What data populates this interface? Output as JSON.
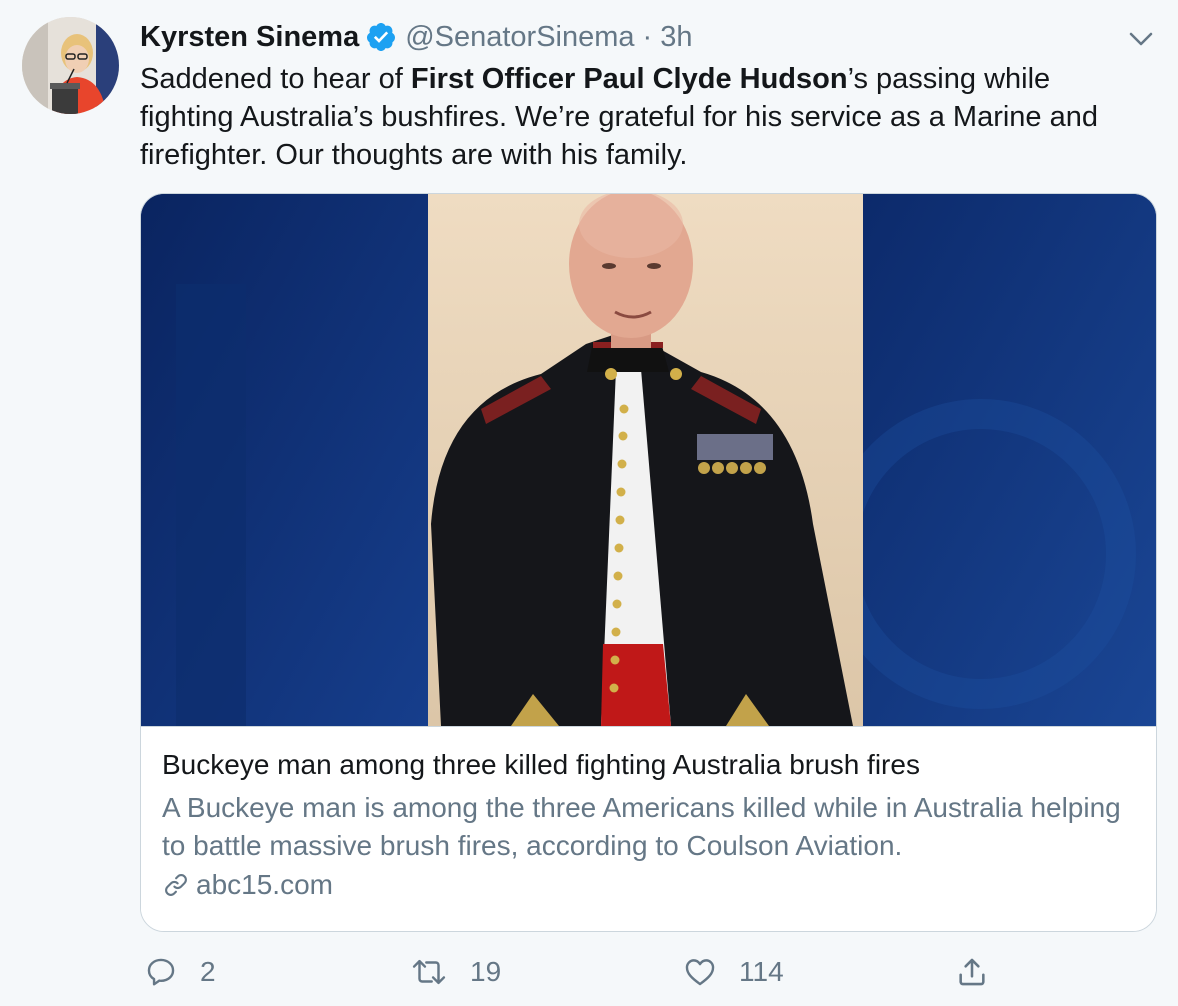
{
  "tweet": {
    "author_name": "Kyrsten Sinema",
    "handle": "@SenatorSinema",
    "separator": "·",
    "time": "3h",
    "text_part1": "Saddened to hear of ",
    "text_bold": "First Officer Paul Clyde Hudson",
    "text_part2": "’s passing while fighting Australia’s bushfires. We’re grateful for his service as a Marine and firefighter. Our thoughts are with his family."
  },
  "card": {
    "title": "Buckeye man among three killed fighting Australia brush fires",
    "description": "A Buckeye man is among the three Americans killed while in Australia helping to battle massive brush fires, according to Coulson Aviation.",
    "domain": "abc15.com"
  },
  "actions": {
    "replies": "2",
    "retweets": "19",
    "likes": "114"
  },
  "icons": {
    "verified": "verified-badge-icon",
    "caret": "chevron-down-icon",
    "reply": "reply-bubble-icon",
    "retweet": "retweet-arrows-icon",
    "like": "heart-icon",
    "share": "share-upload-icon",
    "link": "link-chain-icon"
  },
  "colors": {
    "background": "#f5f8fa",
    "text_primary": "#14171a",
    "text_secondary": "#657786",
    "verified_blue": "#1da1f2",
    "card_border": "#ccd6dd",
    "photo_backdrop": "#0d2a68"
  }
}
